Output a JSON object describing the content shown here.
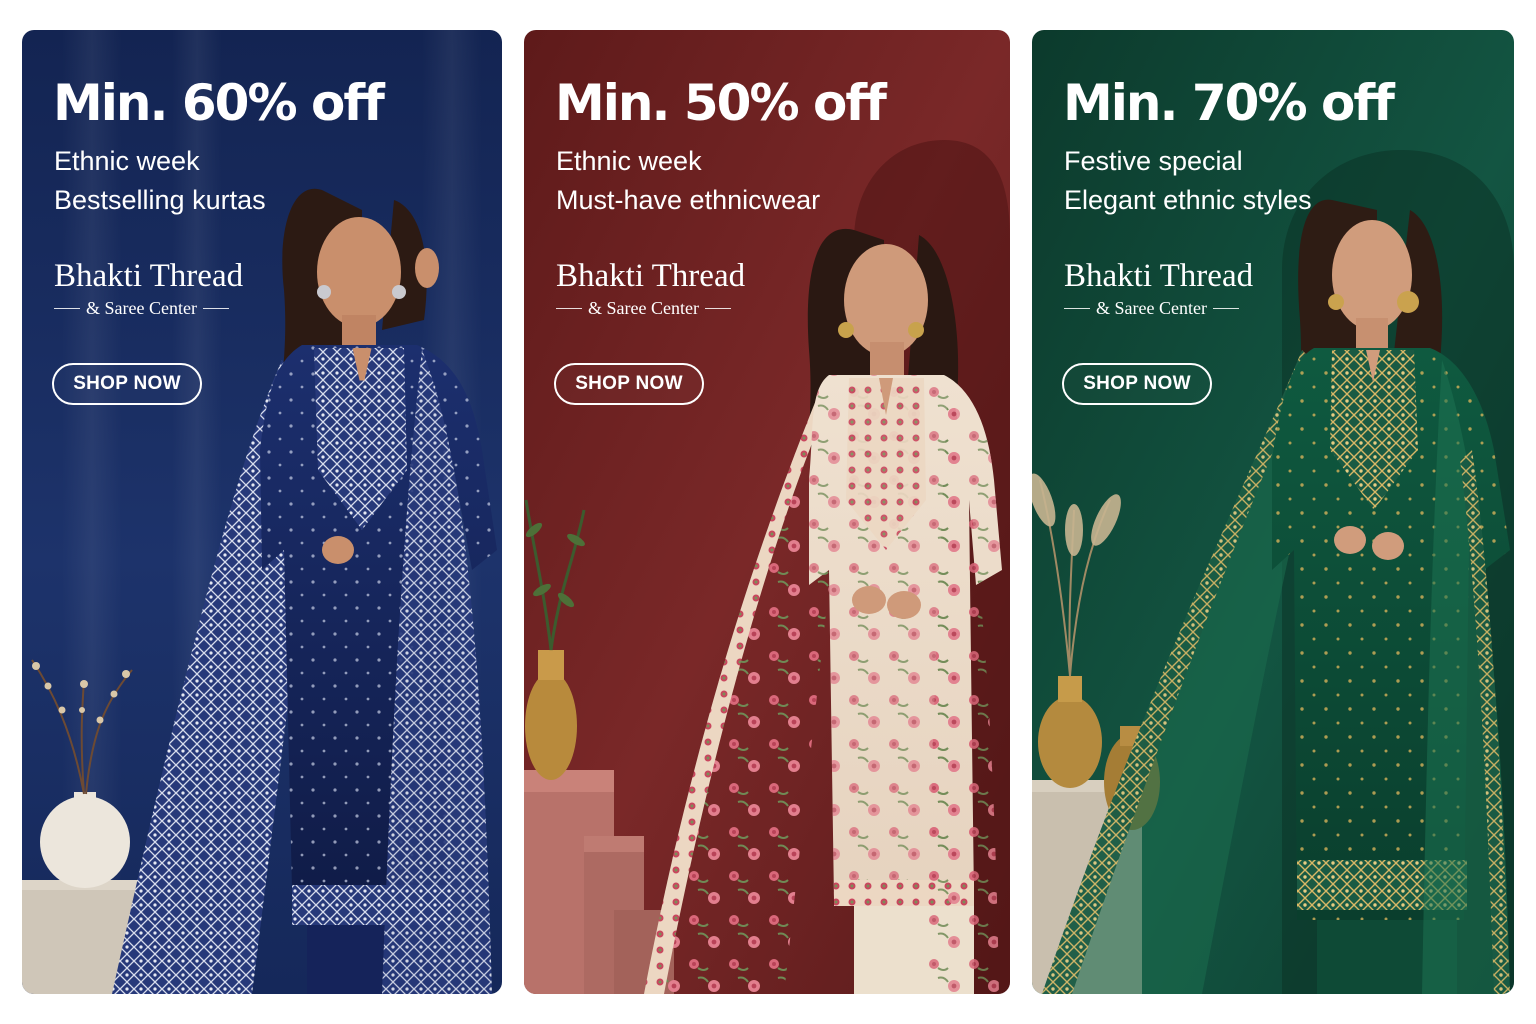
{
  "banners": [
    {
      "headline": "Min. 60% off",
      "line1": "Ethnic week",
      "line2": "Bestselling kurtas",
      "brand_name": "Bhakti Thread",
      "brand_tagline": "& Saree Center",
      "cta": "SHOP NOW",
      "theme_color": "#16285a",
      "outfit": "navy kurta set with silver embroidery"
    },
    {
      "headline": "Min. 50% off",
      "line1": "Ethnic week",
      "line2": "Must-have ethnicwear",
      "brand_name": "Bhakti Thread",
      "brand_tagline": "& Saree Center",
      "cta": "SHOP NOW",
      "theme_color": "#6e2121",
      "outfit": "cream floral print kurta set"
    },
    {
      "headline": "Min. 70% off",
      "line1": "Festive special",
      "line2": "Elegant ethnic styles",
      "brand_name": "Bhakti Thread",
      "brand_tagline": "& Saree Center",
      "cta": "SHOP NOW",
      "theme_color": "#0f4a38",
      "outfit": "emerald kurta set with gold embroidery"
    }
  ]
}
